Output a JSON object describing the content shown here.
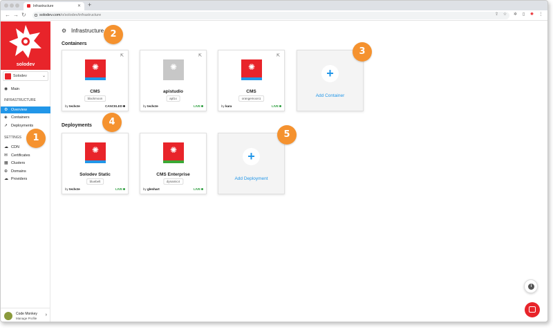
{
  "browser": {
    "tab_title": "Infrastructure",
    "url_host": "solodev.com",
    "url_path": "/o/solodev/infrastructure"
  },
  "sidebar": {
    "brand": "solodev",
    "org_name": "Solodev",
    "main_label": "Main",
    "infra_heading": "INFRASTRUCTURE",
    "infra_items": [
      {
        "label": "Overview",
        "icon": "gear-icon",
        "active": true
      },
      {
        "label": "Containers",
        "icon": "cube-icon",
        "active": false
      },
      {
        "label": "Deployments",
        "icon": "rocket-icon",
        "active": false
      }
    ],
    "settings_heading": "SETTINGS",
    "settings_items": [
      {
        "label": "CDN",
        "icon": "cloud-icon"
      },
      {
        "label": "Certificates",
        "icon": "certificate-icon"
      },
      {
        "label": "Clusters",
        "icon": "cluster-icon"
      },
      {
        "label": "Domains",
        "icon": "globe-icon"
      },
      {
        "label": "Providers",
        "icon": "cloud-icon"
      }
    ],
    "profile": {
      "name": "Code Monkey",
      "action": "Manage Profile"
    }
  },
  "main": {
    "title": "Infrastructure",
    "containers_heading": "Containers",
    "containers": [
      {
        "name": "CMS",
        "tag": "blackmoon",
        "by": "by",
        "author": "techcte",
        "status": "CANCELED",
        "thumb": "red",
        "band": "blue"
      },
      {
        "name": "apistudio",
        "tag": "apl1x",
        "by": "by",
        "author": "techcte",
        "status": "LIVE",
        "thumb": "gray",
        "band": "none"
      },
      {
        "name": "CMS",
        "tag": "orangemoon1",
        "by": "by",
        "author": "kara",
        "status": "LIVE",
        "thumb": "red",
        "band": "blue"
      }
    ],
    "add_container_label": "Add Container",
    "deployments_heading": "Deployments",
    "deployments": [
      {
        "name": "Solodev Static",
        "tag": "bluebelt",
        "by": "by",
        "author": "techcte",
        "status": "LIVE",
        "thumb": "red",
        "band": "blue"
      },
      {
        "name": "CMS Enterprise",
        "tag": "dynamic4",
        "by": "by",
        "author": "glenhart",
        "status": "LIVE",
        "thumb": "red",
        "band": "green"
      }
    ],
    "add_deployment_label": "Add Deployment"
  },
  "callouts": [
    "1",
    "2",
    "3",
    "4",
    "5"
  ],
  "colors": {
    "brand_red": "#e8242a",
    "accent_blue": "#2196e8",
    "live_green": "#2e9e3f",
    "callout_orange": "#f5922f"
  }
}
